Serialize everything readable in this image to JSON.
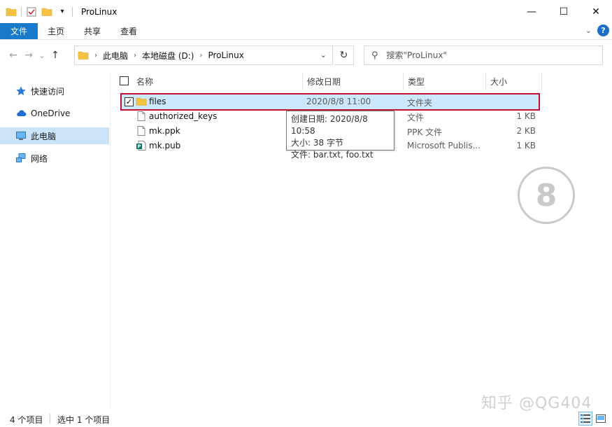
{
  "window": {
    "title": "ProLinux",
    "controls": {
      "minimize": "—",
      "maximize": "☐",
      "close": "✕"
    }
  },
  "ribbon": {
    "tabs": [
      "文件",
      "主页",
      "共享",
      "查看"
    ],
    "help": "?"
  },
  "nav": {
    "back": "←",
    "forward": "→",
    "recent": "⌄",
    "up": "↑",
    "breadcrumb": [
      "此电脑",
      "本地磁盘 (D:)",
      "ProLinux"
    ],
    "refresh": "↻",
    "search_placeholder": "搜索\"ProLinux\""
  },
  "sidebar": {
    "items": [
      {
        "label": "快速访问",
        "icon": "star-icon"
      },
      {
        "label": "OneDrive",
        "icon": "cloud-icon"
      },
      {
        "label": "此电脑",
        "icon": "computer-icon",
        "selected": true
      },
      {
        "label": "网络",
        "icon": "network-icon"
      }
    ]
  },
  "columns": {
    "name": "名称",
    "date": "修改日期",
    "type": "类型",
    "size": "大小"
  },
  "files": [
    {
      "name": "files",
      "date": "2020/8/8 11:00",
      "type": "文件夹",
      "size": "",
      "icon": "folder-icon",
      "selected": true,
      "checked": true
    },
    {
      "name": "authorized_keys",
      "date": "",
      "type": "文件",
      "size": "1 KB",
      "icon": "file-icon"
    },
    {
      "name": "mk.ppk",
      "date": "",
      "type": "PPK 文件",
      "size": "2 KB",
      "icon": "file-icon"
    },
    {
      "name": "mk.pub",
      "date": "",
      "type": "Microsoft Publis...",
      "size": "1 KB",
      "icon": "publisher-icon"
    }
  ],
  "tooltip": {
    "line1": "创建日期: 2020/8/8 10:58",
    "line2": "大小: 38 字节",
    "line3": "文件: bar.txt, foo.txt"
  },
  "badge": "8",
  "watermark": "知乎 @QG404",
  "status": {
    "item_count": "4 个项目",
    "selected_count": "选中 1 个项目"
  },
  "colors": {
    "accent": "#1979ca",
    "selection": "#cce8ff",
    "highlight_border": "#c8102e",
    "folder": "#f5c342"
  }
}
